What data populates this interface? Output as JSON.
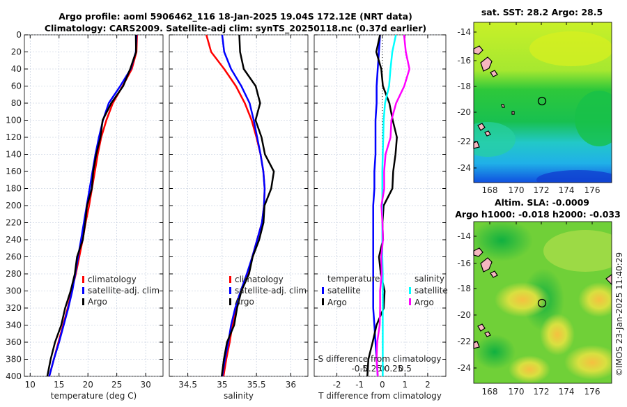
{
  "title_line1": "Argo profile: aoml 5906462_116 18-Jan-2025 19.04S 172.12E (NRT data)",
  "title_line2": "Climatology: CARS2009. Satellite-adj clim: synTS_20250118.nc (0.37d earlier)",
  "copyright": "©IMOS 23-Jan-2025 11:40:29",
  "colors": {
    "climatology": "#ff0000",
    "satellite": "#0000ff",
    "argo": "#000000",
    "sal_satellite": "#00ffff",
    "sal_argo": "#ff00ff"
  },
  "chart_data": [
    {
      "type": "line",
      "xlabel": "temperature (deg C)",
      "xlim": [
        9,
        33
      ],
      "xticks": [
        "10",
        "15",
        "20",
        "25",
        "30"
      ],
      "ylim": [
        0,
        400
      ],
      "yticks": [
        "0",
        "20",
        "40",
        "60",
        "80",
        "100",
        "120",
        "140",
        "160",
        "180",
        "200",
        "220",
        "240",
        "260",
        "280",
        "300",
        "320",
        "340",
        "360",
        "380",
        "400"
      ],
      "y_reversed": true,
      "grid": true,
      "legend": [
        "climatology",
        "satellite-adj. clim",
        "Argo"
      ],
      "legend_placement": "lower-right",
      "depth": [
        0,
        20,
        40,
        60,
        80,
        100,
        120,
        140,
        160,
        180,
        200,
        220,
        240,
        260,
        280,
        300,
        320,
        340,
        360,
        380,
        400
      ],
      "series": [
        {
          "name": "climatology",
          "color": "#ff0000",
          "values": [
            28.5,
            28.4,
            27.6,
            26.0,
            24.3,
            23.2,
            22.3,
            21.7,
            21.2,
            20.7,
            20.2,
            19.6,
            19.1,
            18.5,
            17.9,
            17.2,
            16.5,
            15.7,
            14.9,
            14.1,
            13.3
          ]
        },
        {
          "name": "satellite-adj. clim",
          "color": "#0000ff",
          "values": [
            28.4,
            28.3,
            27.4,
            25.6,
            23.6,
            22.6,
            21.9,
            21.3,
            20.8,
            20.3,
            19.8,
            19.3,
            18.8,
            18.3,
            17.8,
            17.3,
            16.6,
            15.8,
            15.0,
            14.1,
            13.3
          ]
        },
        {
          "name": "Argo",
          "color": "#000000",
          "values": [
            28.3,
            28.2,
            27.5,
            26.0,
            24.0,
            22.7,
            22.0,
            21.5,
            21.0,
            20.5,
            20.0,
            19.5,
            19.0,
            18.3,
            17.6,
            17.0,
            16.2,
            15.2,
            14.4,
            13.6,
            12.8
          ]
        }
      ]
    },
    {
      "type": "line",
      "xlabel": "salinity",
      "xlim": [
        34.23,
        36.25
      ],
      "xticks": [
        "34.5",
        "35",
        "35.5",
        "36"
      ],
      "ylim": [
        0,
        400
      ],
      "y_reversed": true,
      "grid": true,
      "legend": [
        "climatology",
        "satellite-adj. clim",
        "Argo"
      ],
      "legend_placement": "lower-right",
      "depth": [
        0,
        20,
        40,
        60,
        80,
        100,
        120,
        140,
        160,
        180,
        200,
        220,
        240,
        260,
        280,
        300,
        320,
        340,
        360,
        380,
        400
      ],
      "series": [
        {
          "name": "climatology",
          "color": "#ff0000",
          "values": [
            34.77,
            34.84,
            35.03,
            35.2,
            35.33,
            35.43,
            35.5,
            35.56,
            35.6,
            35.62,
            35.61,
            35.58,
            35.51,
            35.44,
            35.37,
            35.28,
            35.2,
            35.15,
            35.11,
            35.06,
            35.02
          ]
        },
        {
          "name": "satellite-adj. clim",
          "color": "#0000ff",
          "values": [
            35.0,
            35.03,
            35.13,
            35.28,
            35.4,
            35.46,
            35.51,
            35.56,
            35.6,
            35.62,
            35.61,
            35.58,
            35.51,
            35.44,
            35.36,
            35.27,
            35.19,
            35.13,
            35.09,
            35.04,
            35.0
          ]
        },
        {
          "name": "Argo",
          "color": "#000000",
          "values": [
            35.25,
            35.25,
            35.33,
            35.48,
            35.55,
            35.5,
            35.56,
            35.63,
            35.76,
            35.7,
            35.63,
            35.6,
            35.53,
            35.46,
            35.38,
            35.28,
            35.23,
            35.16,
            35.08,
            35.03,
            34.98
          ]
        }
      ]
    },
    {
      "type": "line",
      "xlabel": "T difference from climatology",
      "xlim": [
        -3,
        2.8
      ],
      "xticks": [
        "-2",
        "-1",
        "0",
        "1",
        "2"
      ],
      "x2label": "S difference from climatology",
      "x2lim": [
        -1.5,
        1.4
      ],
      "x2ticks": [
        "-0.5",
        "-0.25",
        "0",
        "0.25",
        "0.5"
      ],
      "ylim": [
        0,
        400
      ],
      "y_reversed": true,
      "grid": true,
      "legend_left_title": "temperature",
      "legend_right_title": "salinity",
      "legend_left": [
        "satellite",
        "Argo"
      ],
      "legend_right": [
        "satellite",
        "Argo"
      ],
      "depth": [
        0,
        20,
        40,
        60,
        80,
        100,
        120,
        140,
        160,
        180,
        200,
        220,
        240,
        260,
        280,
        300,
        320,
        340,
        360,
        380,
        400
      ],
      "series": [
        {
          "name": "satellite",
          "variable": "temperature",
          "color": "#0000ff",
          "values": [
            -0.1,
            -0.15,
            -0.2,
            -0.25,
            -0.25,
            -0.3,
            -0.3,
            -0.3,
            -0.35,
            -0.35,
            -0.4,
            -0.4,
            -0.4,
            -0.4,
            -0.4,
            -0.4,
            -0.4,
            -0.35,
            -0.3,
            -0.25,
            -0.2
          ]
        },
        {
          "name": "Argo",
          "variable": "temperature",
          "color": "#000000",
          "values": [
            -0.1,
            -0.3,
            0.0,
            0.0,
            0.3,
            0.5,
            0.6,
            0.6,
            0.5,
            0.4,
            0.1,
            0.0,
            0.0,
            -0.1,
            -0.1,
            0.1,
            0.1,
            -0.3,
            -0.4,
            -0.6,
            -0.7
          ]
        },
        {
          "name": "satellite",
          "variable": "salinity",
          "color": "#00ffff",
          "values": [
            0.3,
            0.22,
            0.18,
            0.15,
            0.06,
            0.03,
            0.02,
            0.01,
            0.0,
            0.0,
            0.0,
            0.0,
            0.0,
            0.0,
            0.01,
            0.01,
            0.01,
            0.01,
            0.01,
            0.01,
            0.01
          ]
        },
        {
          "name": "Argo",
          "variable": "salinity",
          "color": "#ff00ff",
          "values": [
            0.48,
            0.5,
            0.62,
            0.47,
            0.3,
            0.22,
            0.16,
            0.08,
            0.05,
            0.02,
            0.0,
            0.0,
            0.0,
            0.0,
            -0.03,
            -0.05,
            -0.03,
            -0.08,
            -0.1,
            -0.12,
            -0.12
          ]
        }
      ]
    },
    {
      "type": "heatmap",
      "title": "sat. SST: 28.2 Argo: 28.5",
      "xticks": [
        "168",
        "170",
        "172",
        "174",
        "176"
      ],
      "yticks": [
        "-14",
        "-16",
        "-18",
        "-20",
        "-22",
        "-24"
      ],
      "marker": {
        "lon": 172.12,
        "lat": -19.04
      }
    },
    {
      "type": "heatmap",
      "title": "Altim. SLA: -0.0009",
      "subtitle": "Argo h1000: -0.018 h2000: -0.033",
      "xticks": [
        "168",
        "170",
        "172",
        "174",
        "176"
      ],
      "yticks": [
        "-14",
        "-16",
        "-18",
        "-20",
        "-22",
        "-24"
      ],
      "marker": {
        "lon": 172.12,
        "lat": -19.04
      }
    }
  ]
}
